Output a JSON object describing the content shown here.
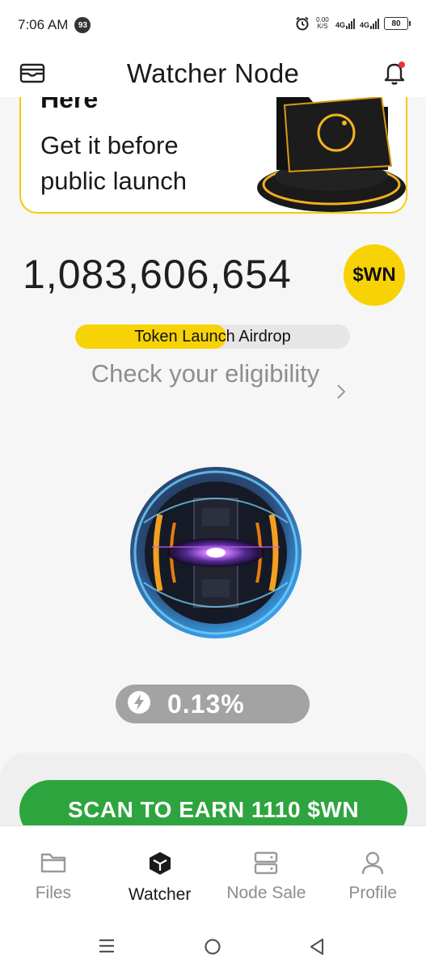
{
  "status_bar": {
    "time": "7:06 AM",
    "notification_count": "93",
    "net_speed_value": "0.00",
    "net_speed_unit": "K/S",
    "signal1_label": "4G",
    "signal2_label": "4G",
    "battery": "80"
  },
  "header": {
    "title": "Watcher Node",
    "wallet_icon": "wallet-icon",
    "bell_icon": "bell-icon",
    "notification_dot_color": "#e53935"
  },
  "promo": {
    "heading": "Here",
    "text": "Get it before public launch",
    "border_color": "#f2cc0c"
  },
  "balance": {
    "value": "1,083,606,654",
    "token_symbol": "$WN",
    "token_color": "#f7d306"
  },
  "airdrop": {
    "label": "Token Launch Airdrop",
    "progress": 0.55
  },
  "eligibility": {
    "text": "Check your eligibility"
  },
  "boost": {
    "value": "0.13%"
  },
  "scan_button": {
    "label": "SCAN TO EARN 1110 $WN",
    "color": "#2ea43e"
  },
  "bottom_nav": {
    "items": [
      {
        "label": "Files",
        "icon": "folder-icon",
        "active": false
      },
      {
        "label": "Watcher",
        "icon": "cube-icon",
        "active": true
      },
      {
        "label": "Node Sale",
        "icon": "server-icon",
        "active": false
      },
      {
        "label": "Profile",
        "icon": "user-icon",
        "active": false
      }
    ]
  }
}
